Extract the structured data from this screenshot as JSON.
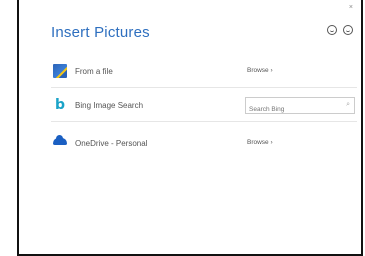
{
  "dialog": {
    "title": "Insert Pictures",
    "close_glyph": "×"
  },
  "sources": [
    {
      "label": "From a file",
      "action": "Browse ›",
      "icon": "folder-picture-icon"
    },
    {
      "label": "Bing Image Search",
      "placeholder": "Search Bing",
      "icon": "bing-icon"
    },
    {
      "label": "OneDrive - Personal",
      "action": "Browse ›",
      "icon": "onedrive-cloud-icon"
    }
  ],
  "colors": {
    "title": "#2e6fbf",
    "bing": "#1aa3c8",
    "onedrive": "#1a5fc2"
  }
}
